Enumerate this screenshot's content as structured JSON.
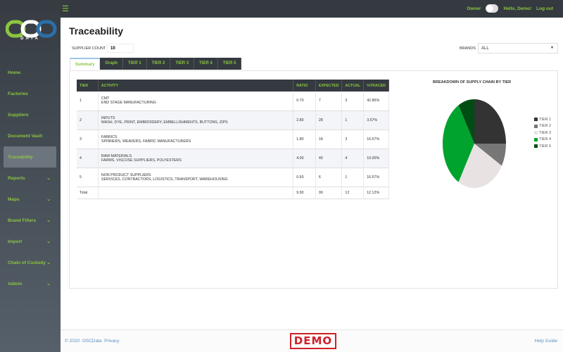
{
  "brand": {
    "logo_text": "DATA"
  },
  "topbar": {
    "owner_label": "Owner",
    "greeting": "Hello, Demo!",
    "logout": "Log out"
  },
  "sidebar": {
    "items": [
      {
        "label": "Home",
        "has_chevron": false
      },
      {
        "label": "Factories",
        "has_chevron": false
      },
      {
        "label": "Suppliers",
        "has_chevron": false
      },
      {
        "label": "Document Vault",
        "has_chevron": false
      },
      {
        "label": "Traceability",
        "has_chevron": false,
        "active": true
      },
      {
        "label": "Reports",
        "has_chevron": true
      },
      {
        "label": "Maps",
        "has_chevron": true
      },
      {
        "label": "Brand Filters",
        "has_chevron": true
      },
      {
        "label": "Import",
        "has_chevron": true
      },
      {
        "label": "Chain of Custody",
        "has_chevron": true
      },
      {
        "label": "Admin",
        "has_chevron": true
      }
    ]
  },
  "page": {
    "title": "Traceability",
    "supplier_count_label": "SUPPLIER COUNT",
    "supplier_count": "10",
    "brands_label": "BRANDS",
    "brands_value": "ALL"
  },
  "tabs": [
    "Summary",
    "Graph",
    "TIER 1",
    "TIER 2",
    "TIER 3",
    "TIER 4",
    "TIER 5"
  ],
  "table": {
    "headers": [
      "TIER",
      "ACTIVITY",
      "RATIO",
      "EXPECTED",
      "ACTUAL",
      "%TRACED"
    ],
    "rows": [
      {
        "tier": "1",
        "name": "CMT",
        "desc": "END STAGE MANUFACTURING",
        "ratio": "0.70",
        "expected": "7",
        "actual": "3",
        "traced": "42.86%"
      },
      {
        "tier": "2",
        "name": "INPUTS",
        "desc": "WASH, DYE, PRINT, EMBROIDERY, EMBELLISHMENTS, BUTTONS, ZIPS",
        "ratio": "2.80",
        "expected": "28",
        "actual": "1",
        "traced": "3.57%"
      },
      {
        "tier": "3",
        "name": "FABRICS",
        "desc": "SPINNERS, WEAVERS, FABRIC MANUFACTURERS",
        "ratio": "1.80",
        "expected": "18",
        "actual": "3",
        "traced": "16.67%"
      },
      {
        "tier": "4",
        "name": "RAW MATERIALS",
        "desc": "FARMS, VISCOSE SUPPLIERS, POLYESTERS",
        "ratio": "4.00",
        "expected": "40",
        "actual": "4",
        "traced": "10.00%"
      },
      {
        "tier": "5",
        "name": "NON PRODUCT SUPPLIERS",
        "desc": "SERVICES, CONTRACTORS, LOGISTICS, TRANSPORT, WAREHOUSING",
        "ratio": "0.60",
        "expected": "6",
        "actual": "1",
        "traced": "16.67%"
      }
    ],
    "total": {
      "label": "Total",
      "ratio": "9.90",
      "expected": "99",
      "actual": "12",
      "traced": "12.12%"
    }
  },
  "chart_data": {
    "type": "pie",
    "title": "BREAKDOWN OF SUPPLY CHAIN BY TIER",
    "legend_position": "right",
    "categories": [
      "TIER 1",
      "TIER 2",
      "TIER 3",
      "TIER 4",
      "TIER 5"
    ],
    "values": [
      3,
      1,
      3,
      4,
      1
    ],
    "colors": [
      "#333333",
      "#777777",
      "#e8e2e2",
      "#00a32e",
      "#004d14"
    ]
  },
  "footer": {
    "copyright": "© 2020",
    "company": "OSCData",
    "privacy": "Privacy",
    "demo": "DEMO",
    "help": "Help Guide"
  }
}
